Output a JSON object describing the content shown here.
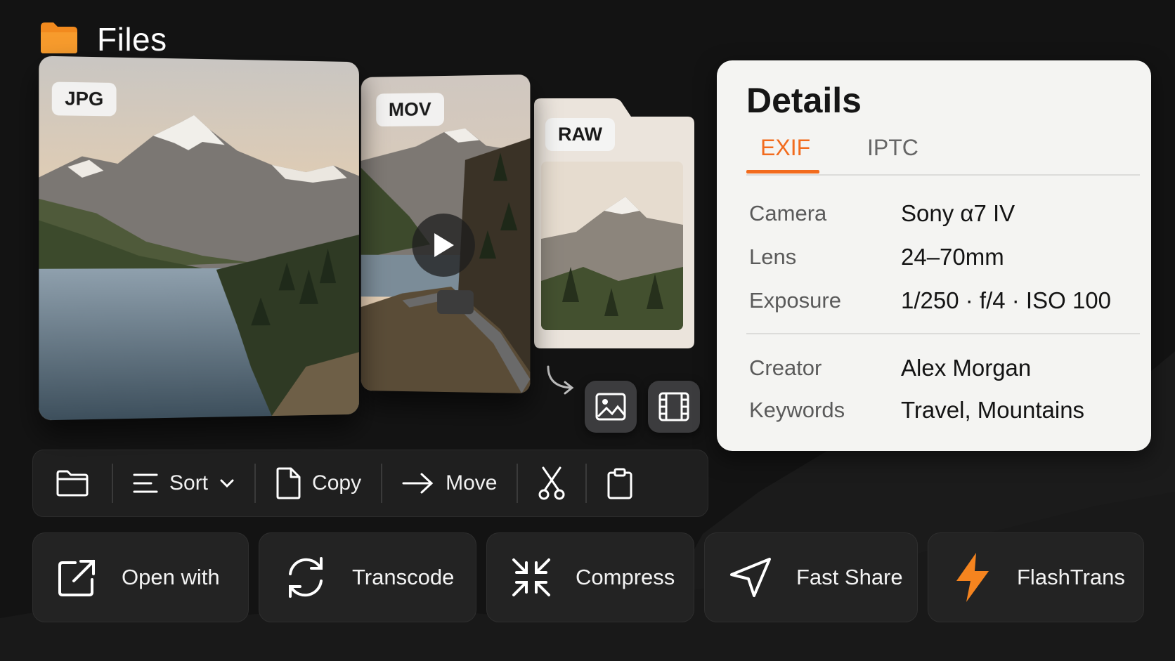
{
  "header": {
    "title": "Files",
    "icon": "folder-icon",
    "icon_color": "#f28a1e"
  },
  "cards": {
    "jpg": {
      "tag": "JPG"
    },
    "mov": {
      "tag": "MOV"
    },
    "raw": {
      "tag": "RAW"
    }
  },
  "details": {
    "title": "Details",
    "tabs": [
      {
        "label": "EXIF",
        "active": true
      },
      {
        "label": "IPTC",
        "active": false
      }
    ],
    "exif": [
      {
        "key": "Camera",
        "value": "Sony α7 IV"
      },
      {
        "key": "Lens",
        "value": "24–70mm"
      },
      {
        "key": "Exposure",
        "value": "1/250 · f/4 · ISO 100"
      }
    ],
    "iptc": [
      {
        "key": "Creator",
        "value": "Alex Morgan"
      },
      {
        "key": "Keywords",
        "value": "Travel, Mountains"
      }
    ]
  },
  "toolbar": {
    "sort_label": "Sort",
    "copy_label": "Copy",
    "move_label": "Move"
  },
  "actions": [
    {
      "label": "Open with",
      "icon": "external-link-icon"
    },
    {
      "label": "Transcode",
      "icon": "refresh-icon"
    },
    {
      "label": "Compress",
      "icon": "compress-icon"
    },
    {
      "label": "Fast Share",
      "icon": "send-icon"
    },
    {
      "label": "FlashTrans",
      "icon": "lightning-icon"
    }
  ],
  "colors": {
    "accent": "#f26b1d",
    "flash": "#f5841f",
    "panel": "#f4f4f2",
    "background": "#131313"
  }
}
